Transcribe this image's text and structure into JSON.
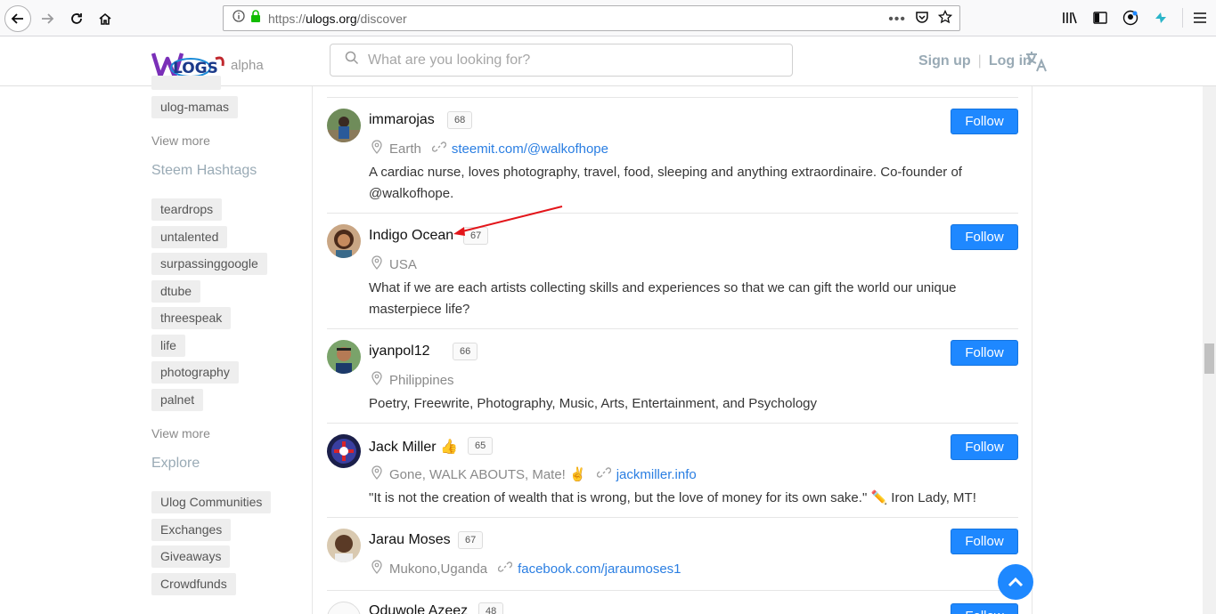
{
  "browser": {
    "url_prefix": "https://",
    "url_domain": "ulogs.org",
    "url_path": "/discover"
  },
  "header": {
    "logo_suffix": "alpha",
    "search_placeholder": "What are you looking for?",
    "signup": "Sign up",
    "separator": "|",
    "login": "Log in"
  },
  "sidebar": {
    "top_tags": [
      "ulog-mamas"
    ],
    "view_more_1": "View more",
    "steem_heading": "Steem Hashtags",
    "hashtags": [
      "teardrops",
      "untalented",
      "surpassinggoogle",
      "dtube",
      "threespeak",
      "life",
      "photography",
      "palnet"
    ],
    "view_more_2": "View more",
    "explore_heading": "Explore",
    "explore_items": [
      "Ulog Communities",
      "Exchanges",
      "Giveaways",
      "Crowdfunds"
    ]
  },
  "users": [
    {
      "name": "immarojas",
      "rep": "68",
      "location": "Earth",
      "link": "steemit.com/@walkofhope",
      "bio": "A cardiac nurse, loves photography, travel, food, sleeping and anything extraordinaire. Co-founder of @walkofhope.",
      "follow": "Follow"
    },
    {
      "name": "Indigo Ocean",
      "rep": "67",
      "location": "USA",
      "link": "",
      "bio": "What if we are each artists collecting skills and experiences so that we can gift the world our unique masterpiece life?",
      "follow": "Follow"
    },
    {
      "name": "iyanpol12",
      "rep": "66",
      "location": "Philippines",
      "link": "",
      "bio": "Poetry, Freewrite, Photography, Music, Arts, Entertainment, and Psychology",
      "follow": "Follow"
    },
    {
      "name": "Jack Miller 👍",
      "rep": "65",
      "location": "Gone, WALK ABOUTS, Mate! ✌",
      "link": "jackmiller.info",
      "bio": "\"It is not the creation of wealth that is wrong, but the love of money for its own sake.\" ✏️ Iron Lady, MT!",
      "follow": "Follow"
    },
    {
      "name": "Jarau Moses",
      "rep": "67",
      "location": "Mukono,Uganda",
      "link": "facebook.com/jaraumoses1",
      "bio": "",
      "follow": "Follow"
    },
    {
      "name": "Oduwole Azeez",
      "rep": "48",
      "location": "",
      "link": "",
      "bio": "",
      "follow": "Follow"
    }
  ],
  "colors": {
    "accent": "#1e88ff",
    "link": "#2a7ee2",
    "annotation_arrow": "#e3151a"
  }
}
